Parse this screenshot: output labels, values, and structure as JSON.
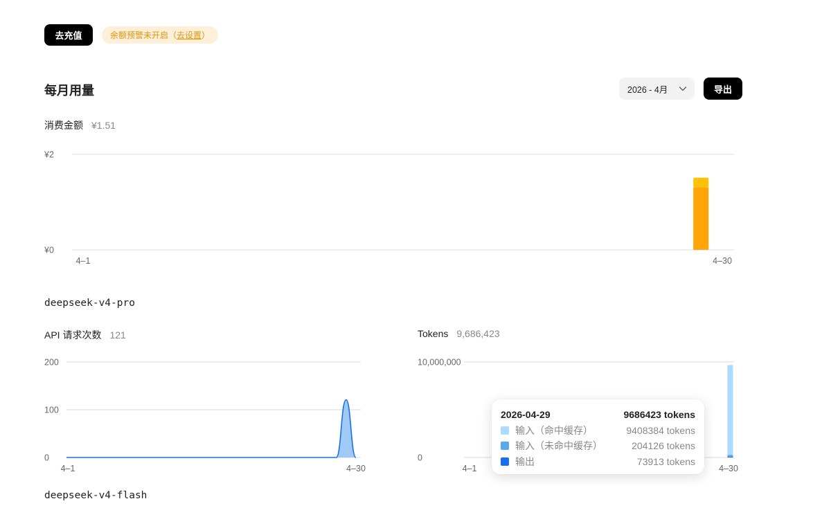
{
  "top": {
    "recharge_label": "去充值",
    "alert_text": "余额预警未开启（",
    "alert_link": "去设置",
    "alert_suffix": "）"
  },
  "usage": {
    "title": "每月用量",
    "month_value": "2026 - 4月",
    "export_label": "导出"
  },
  "cost": {
    "label": "消费金额",
    "value": "¥1.51"
  },
  "models": [
    {
      "name": "deepseek-v4-pro",
      "requests": {
        "label": "API 请求次数",
        "value": "121"
      },
      "tokens": {
        "label": "Tokens",
        "value": "9,686,423"
      }
    },
    {
      "name": "deepseek-v4-flash"
    }
  ],
  "tooltip": {
    "date": "2026-04-29",
    "total": "9686423 tokens",
    "rows": [
      {
        "label": "输入（命中缓存）",
        "value": "9408384 tokens",
        "color": "#a9dcff"
      },
      {
        "label": "输入（未命中缓存）",
        "value": "204126 tokens",
        "color": "#5aa9f0"
      },
      {
        "label": "输出",
        "value": "73913 tokens",
        "color": "#1570ef"
      }
    ]
  },
  "colors": {
    "cost_bar_main": "#ffa50a",
    "cost_bar_top": "#ffc107",
    "requests_area": "#9cc6f5",
    "requests_line": "#1570ef",
    "token_cache_hit": "#a9dcff",
    "token_cache_miss": "#5aa9f0",
    "token_output": "#1570ef",
    "grid": "#d9d9e3"
  },
  "chart_data": [
    {
      "type": "bar",
      "stacked": true,
      "ylim": [
        0,
        2
      ],
      "yticks": [
        "¥0",
        "¥2"
      ],
      "xticks": [
        "4–1",
        "4–30"
      ],
      "categories": [
        "4-29"
      ],
      "series": [
        {
          "values": [
            1.31
          ]
        },
        {
          "values": [
            0.2
          ]
        }
      ]
    },
    {
      "type": "area",
      "ylim": [
        0,
        200
      ],
      "yticks": [
        "0",
        "100",
        "200"
      ],
      "xticks": [
        "4–1",
        "4–30"
      ],
      "x": [
        "4-1",
        "4-27",
        "4-28",
        "4-29",
        "4-30"
      ],
      "y": [
        0,
        0,
        0,
        121,
        0
      ]
    },
    {
      "type": "bar",
      "stacked": true,
      "ylim": [
        0,
        10000000
      ],
      "yticks": [
        "0",
        "10,000,000"
      ],
      "xticks": [
        "4–1",
        "4–30"
      ],
      "categories": [
        "4-29"
      ],
      "series": [
        {
          "name": "输入（命中缓存）",
          "values": [
            9408384
          ]
        },
        {
          "name": "输入（未命中缓存）",
          "values": [
            204126
          ]
        },
        {
          "name": "输出",
          "values": [
            73913
          ]
        }
      ]
    }
  ]
}
